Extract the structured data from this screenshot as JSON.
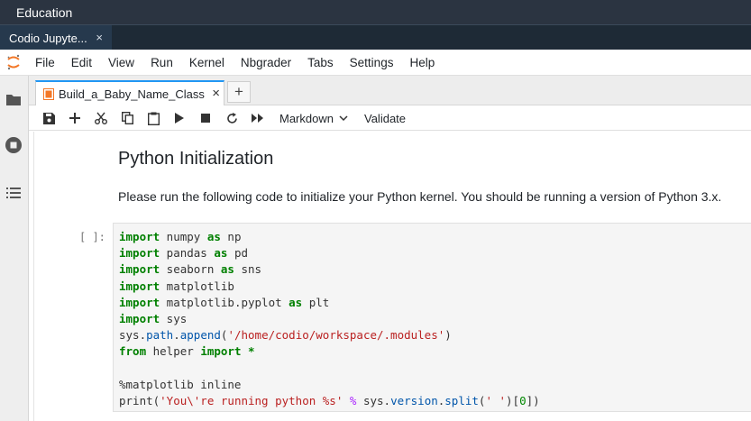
{
  "window": {
    "title": "Education"
  },
  "browser_tab": {
    "label": "Codio Jupyte...",
    "close": "×"
  },
  "menu": {
    "items": [
      "File",
      "Edit",
      "View",
      "Run",
      "Kernel",
      "Nbgrader",
      "Tabs",
      "Settings",
      "Help"
    ]
  },
  "doc_tab": {
    "label": "Build_a_Baby_Name_Class",
    "close": "×",
    "add": "+"
  },
  "toolbar": {
    "cell_type": "Markdown",
    "validate": "Validate"
  },
  "notebook": {
    "heading": "Python Initialization",
    "paragraph": "Please run the following code to initialize your Python kernel. You should be running a version of Python 3.x.",
    "prompt": "[ ]:",
    "code_lines": [
      [
        [
          "kw",
          "import"
        ],
        [
          "pl",
          " numpy "
        ],
        [
          "kw",
          "as"
        ],
        [
          "pl",
          " np"
        ]
      ],
      [
        [
          "kw",
          "import"
        ],
        [
          "pl",
          " pandas "
        ],
        [
          "kw",
          "as"
        ],
        [
          "pl",
          " pd"
        ]
      ],
      [
        [
          "kw",
          "import"
        ],
        [
          "pl",
          " seaborn "
        ],
        [
          "kw",
          "as"
        ],
        [
          "pl",
          " sns"
        ]
      ],
      [
        [
          "kw",
          "import"
        ],
        [
          "pl",
          " matplotlib"
        ]
      ],
      [
        [
          "kw",
          "import"
        ],
        [
          "pl",
          " matplotlib.pyplot "
        ],
        [
          "kw",
          "as"
        ],
        [
          "pl",
          " plt"
        ]
      ],
      [
        [
          "kw",
          "import"
        ],
        [
          "pl",
          " sys"
        ]
      ],
      [
        [
          "pl",
          "sys."
        ],
        [
          "attr",
          "path"
        ],
        [
          "pl",
          "."
        ],
        [
          "attr",
          "append"
        ],
        [
          "pl",
          "("
        ],
        [
          "str",
          "'/home/codio/workspace/.modules'"
        ],
        [
          "pl",
          ")"
        ]
      ],
      [
        [
          "kw",
          "from"
        ],
        [
          "pl",
          " helper "
        ],
        [
          "kw",
          "import"
        ],
        [
          "pl",
          " "
        ],
        [
          "kw",
          "*"
        ]
      ],
      [
        [
          "pl",
          ""
        ]
      ],
      [
        [
          "pl",
          "%matplotlib inline"
        ]
      ],
      [
        [
          "pl",
          "print("
        ],
        [
          "str",
          "'You\\'re running python %s'"
        ],
        [
          "pl",
          " "
        ],
        [
          "op",
          "%"
        ],
        [
          "pl",
          " sys."
        ],
        [
          "attr",
          "version"
        ],
        [
          "pl",
          "."
        ],
        [
          "attr",
          "split"
        ],
        [
          "pl",
          "("
        ],
        [
          "str",
          "' '"
        ],
        [
          "pl",
          ")["
        ],
        [
          "num",
          "0"
        ],
        [
          "pl",
          "])"
        ]
      ]
    ]
  },
  "colors": {
    "topbar": "#2b3441",
    "tab_active_accent": "#2196f3",
    "keyword": "#008000",
    "string": "#ba2121",
    "logo": "#f37726"
  },
  "icons": {
    "sidebar": [
      "folder-icon",
      "stop-circle-icon",
      "list-icon"
    ],
    "toolbar": [
      "save-icon",
      "add-icon",
      "cut-icon",
      "copy-icon",
      "paste-icon",
      "run-icon",
      "stop-icon",
      "restart-icon",
      "fast-forward-icon"
    ]
  }
}
